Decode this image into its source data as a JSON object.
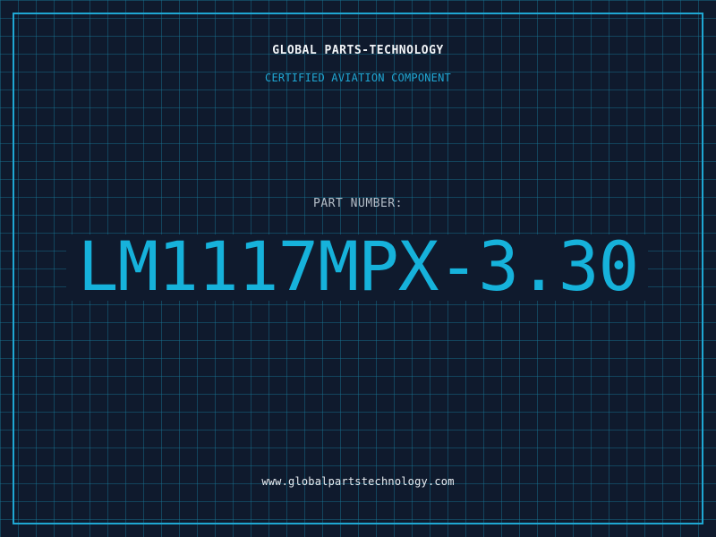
{
  "header": {
    "brand": "GLOBAL PARTS-TECHNOLOGY",
    "subtitle": "CERTIFIED AVIATION COMPONENT"
  },
  "part": {
    "label": "PART NUMBER:",
    "number": "LM1117MPX-3.30"
  },
  "footer": {
    "website": "www.globalpartstechnology.com"
  },
  "colors": {
    "background": "#0f1a2d",
    "grid": "#1878a0",
    "accent": "#1fa7d3",
    "part_number": "#16b2db",
    "text_light": "#f2f5f8",
    "text_muted": "#b5bec8"
  }
}
